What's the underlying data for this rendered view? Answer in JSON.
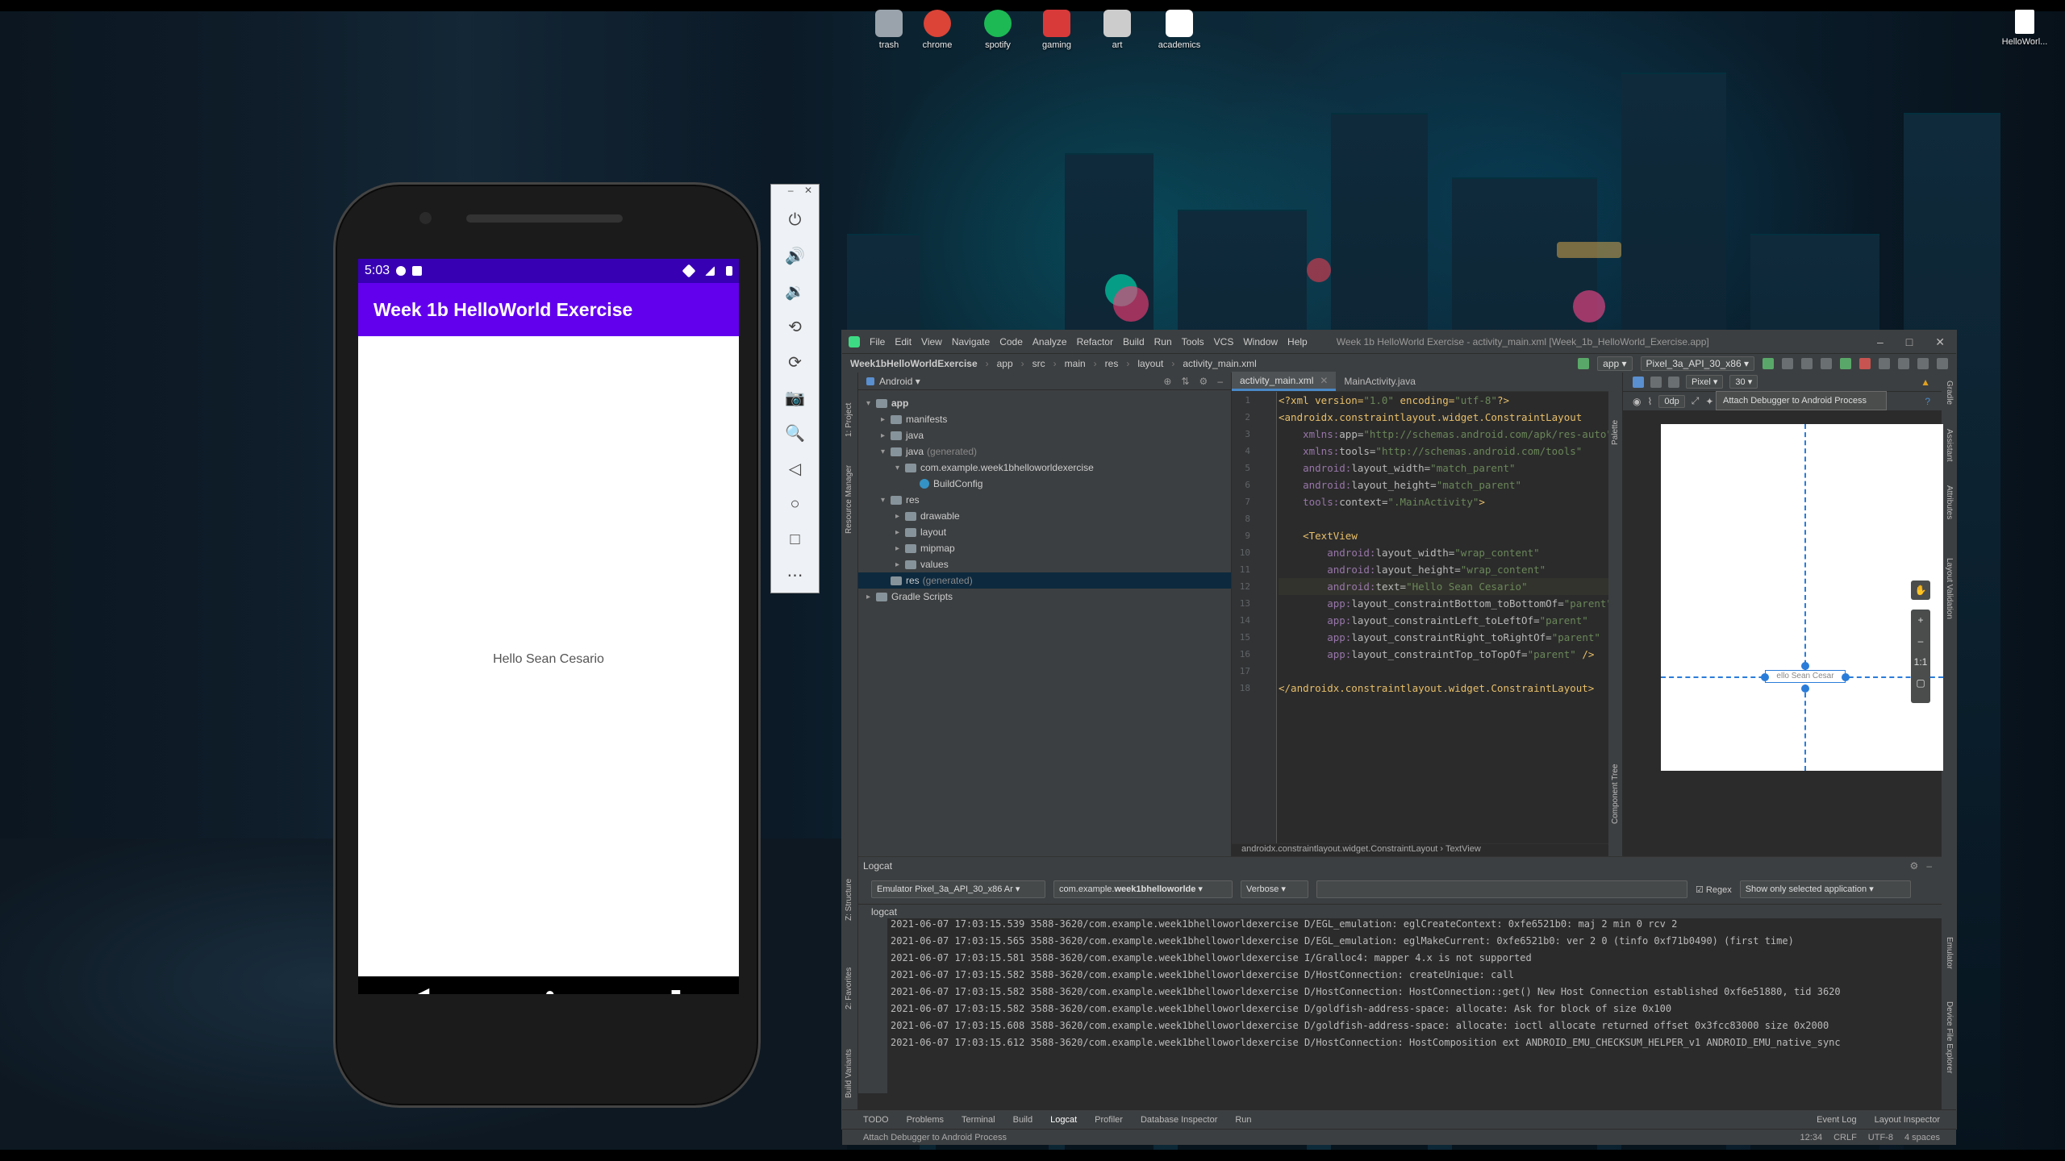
{
  "desktop": {
    "icons": [
      {
        "label": "trash",
        "name": "trash-icon",
        "color": "#9aa3ab"
      },
      {
        "label": "chrome",
        "name": "chrome-icon",
        "color": "#db4437"
      },
      {
        "label": "spotify",
        "name": "spotify-icon",
        "color": "#1db954"
      },
      {
        "label": "gaming",
        "name": "gaming-icon",
        "color": "#d83a3a"
      },
      {
        "label": "art",
        "name": "art-icon",
        "color": "#cccccc"
      },
      {
        "label": "academics",
        "name": "academics-icon",
        "color": "#ffffff"
      }
    ],
    "corner_icon": {
      "label": "HelloWorl...",
      "name": "helloworld-file-icon"
    }
  },
  "phone": {
    "status": {
      "time": "5:03"
    },
    "app_title": "Week 1b HelloWorld Exercise",
    "hello_text": "Hello Sean Cesario",
    "nav": {
      "back": "◀",
      "home": "●",
      "recents": "■"
    }
  },
  "emulator_tools": {
    "minimize": "–",
    "close": "✕",
    "buttons": [
      {
        "name": "power-icon",
        "glyph": "⏻"
      },
      {
        "name": "volume-up-icon",
        "glyph": "🔊"
      },
      {
        "name": "volume-down-icon",
        "glyph": "🔉"
      },
      {
        "name": "rotate-left-icon",
        "glyph": "⟲"
      },
      {
        "name": "rotate-right-icon",
        "glyph": "⟳"
      },
      {
        "name": "camera-icon",
        "glyph": "📷"
      },
      {
        "name": "zoom-icon",
        "glyph": "🔍"
      },
      {
        "name": "back-icon",
        "glyph": "◁"
      },
      {
        "name": "home-icon",
        "glyph": "○"
      },
      {
        "name": "overview-icon",
        "glyph": "□"
      },
      {
        "name": "more-icon",
        "glyph": "⋯"
      }
    ]
  },
  "studio": {
    "menu": [
      "File",
      "Edit",
      "View",
      "Navigate",
      "Code",
      "Analyze",
      "Refactor",
      "Build",
      "Run",
      "Tools",
      "VCS",
      "Window",
      "Help"
    ],
    "window_title": "Week 1b HelloWorld Exercise - activity_main.xml [Week_1b_HelloWorld_Exercise.app]",
    "breadcrumb": [
      "Week1bHelloWorldExercise",
      "app",
      "src",
      "main",
      "res",
      "layout",
      "activity_main.xml"
    ],
    "run_config": "app",
    "device": "Pixel_3a_API_30_x86",
    "tooltip": "Attach Debugger to Android Process",
    "project_view": "Android",
    "tree": [
      {
        "indent": 0,
        "arrow": "▾",
        "label": "app",
        "bold": true,
        "type": "folder"
      },
      {
        "indent": 1,
        "arrow": "▸",
        "label": "manifests",
        "type": "folder"
      },
      {
        "indent": 1,
        "arrow": "▸",
        "label": "java",
        "type": "folder"
      },
      {
        "indent": 1,
        "arrow": "▾",
        "label": "java",
        "suffix": "(generated)",
        "type": "folder"
      },
      {
        "indent": 2,
        "arrow": "▾",
        "label": "com.example.week1bhelloworldexercise",
        "type": "folder"
      },
      {
        "indent": 3,
        "arrow": "",
        "label": "BuildConfig",
        "type": "class"
      },
      {
        "indent": 1,
        "arrow": "▾",
        "label": "res",
        "type": "folder"
      },
      {
        "indent": 2,
        "arrow": "▸",
        "label": "drawable",
        "type": "folder"
      },
      {
        "indent": 2,
        "arrow": "▸",
        "label": "layout",
        "type": "folder"
      },
      {
        "indent": 2,
        "arrow": "▸",
        "label": "mipmap",
        "type": "folder"
      },
      {
        "indent": 2,
        "arrow": "▸",
        "label": "values",
        "type": "folder"
      },
      {
        "indent": 1,
        "arrow": "",
        "label": "res",
        "suffix": "(generated)",
        "type": "folder",
        "selected": true
      },
      {
        "indent": 0,
        "arrow": "▸",
        "label": "Gradle Scripts",
        "type": "gradle"
      }
    ],
    "tabs": [
      {
        "label": "activity_main.xml",
        "active": true
      },
      {
        "label": "MainActivity.java",
        "active": false
      }
    ],
    "code_breadcrumb": "androidx.constraintlayout.widget.ConstraintLayout  ›  TextView",
    "design": {
      "device": "Pixel",
      "api": "30",
      "margin": "0dp",
      "preview_text": "ello Sean Cesar"
    },
    "logcat": {
      "title": "Logcat",
      "device": "Emulator Pixel_3a_API_30_x86 Ar",
      "process_prefix": "com.example.",
      "process_bold": "week1bhelloworlde",
      "level": "Verbose",
      "regex_label": "Regex",
      "filter": "Show only selected application",
      "sub_label": "logcat",
      "lines": [
        "2021-06-07 17:03:15.539 3588-3620/com.example.week1bhelloworldexercise D/EGL_emulation: eglCreateContext: 0xfe6521b0: maj 2 min 0 rcv 2",
        "2021-06-07 17:03:15.565 3588-3620/com.example.week1bhelloworldexercise D/EGL_emulation: eglMakeCurrent: 0xfe6521b0: ver 2 0 (tinfo 0xf71b0490) (first time)",
        "2021-06-07 17:03:15.581 3588-3620/com.example.week1bhelloworldexercise I/Gralloc4: mapper 4.x is not supported",
        "2021-06-07 17:03:15.582 3588-3620/com.example.week1bhelloworldexercise D/HostConnection: createUnique: call",
        "2021-06-07 17:03:15.582 3588-3620/com.example.week1bhelloworldexercise D/HostConnection: HostConnection::get() New Host Connection established 0xf6e51880, tid 3620",
        "2021-06-07 17:03:15.582 3588-3620/com.example.week1bhelloworldexercise D/goldfish-address-space: allocate: Ask for block of size 0x100",
        "2021-06-07 17:03:15.608 3588-3620/com.example.week1bhelloworldexercise D/goldfish-address-space: allocate: ioctl allocate returned offset 0x3fcc83000 size 0x2000",
        "2021-06-07 17:03:15.612 3588-3620/com.example.week1bhelloworldexercise D/HostConnection: HostComposition ext ANDROID_EMU_CHECKSUM_HELPER_v1 ANDROID_EMU_native_sync"
      ]
    },
    "bottom_tools": [
      "TODO",
      "Problems",
      "Terminal",
      "Build",
      "Logcat",
      "Profiler",
      "Database Inspector",
      "Run"
    ],
    "bottom_right_tools": [
      "Event Log",
      "Layout Inspector"
    ],
    "status_message": "Attach Debugger to Android Process",
    "status_right": [
      "12:34",
      "CRLF",
      "UTF-8",
      "4 spaces"
    ],
    "side_labels_left": [
      "1: Project",
      "Resource Manager",
      "Z: Structure",
      "2: Favorites",
      "Build Variants"
    ],
    "side_labels_right": [
      "Gradle",
      "Assistant",
      "Attributes",
      "Layout Validation",
      "Emulator",
      "Device File Explorer"
    ],
    "palette_label": "Palette",
    "component_tree_label": "Component Tree"
  }
}
